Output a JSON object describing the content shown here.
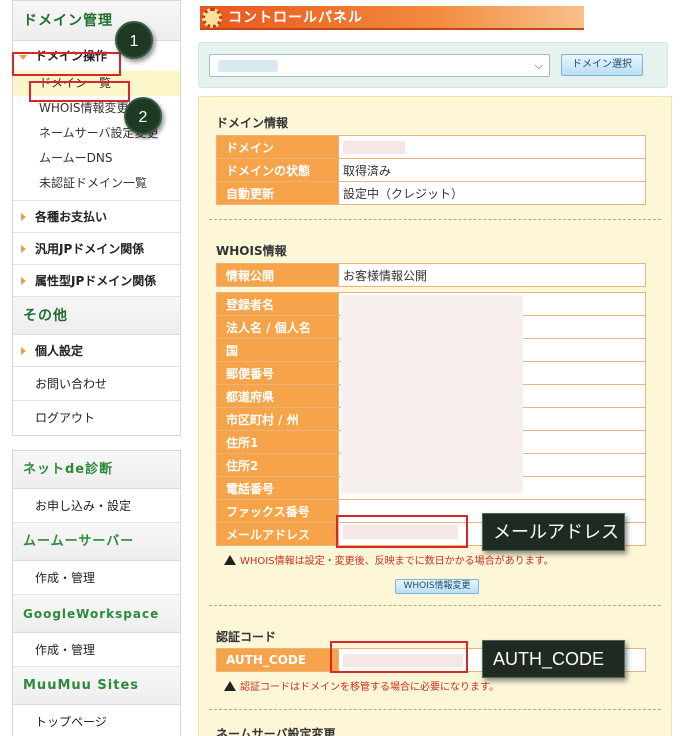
{
  "sidebar": {
    "domain_header": "ドメイン管理",
    "domain_ops": "ドメイン操作",
    "sub_items": [
      "ドメイン一覧",
      "WHOIS情報変更",
      "ネームサーバ設定変更",
      "ムームーDNS",
      "未認証ドメイン一覧"
    ],
    "sections": [
      "各種お支払い",
      "汎用JPドメイン関係",
      "属性型JPドメイン関係"
    ],
    "other_header": "その他",
    "other_items": [
      "個人設定",
      "お問い合わせ",
      "ログアウト"
    ],
    "shindan_header": "ネットde診断",
    "shindan_item": "お申し込み・設定",
    "server_header": "ムームーサーバー",
    "server_item": "作成・管理",
    "gws_header": "GoogleWorkspace",
    "gws_item": "作成・管理",
    "sites_header": "MuuMuu Sites",
    "sites_item": "トップページ"
  },
  "badges": [
    "1",
    "2"
  ],
  "main": {
    "title": "コントロールパネル",
    "select_button": "ドメイン選択",
    "domain_info": {
      "title": "ドメイン情報",
      "rows": [
        {
          "label": "ドメイン",
          "value": ""
        },
        {
          "label": "ドメインの状態",
          "value": "取得済み"
        },
        {
          "label": "自動更新",
          "value": "設定中（クレジット）"
        }
      ]
    },
    "whois": {
      "title": "WHOIS情報",
      "public_label": "情報公開",
      "public_value": "お客様情報公開",
      "rows": [
        "登録者名",
        "法人名 / 個人名",
        "国",
        "郵便番号",
        "都道府県",
        "市区町村 / 州",
        "住所1",
        "住所2",
        "電話番号",
        "ファックス番号",
        "メールアドレス"
      ],
      "warning": "WHOIS情報は設定・変更後、反映までに数日かかる場合があります。",
      "change_button": "WHOIS情報変更"
    },
    "auth": {
      "title": "認証コード",
      "label": "AUTH_CODE",
      "warning": "認証コードはドメインを移管する場合に必要になります。"
    },
    "ns_title": "ネームサーバ設定変更"
  },
  "callouts": {
    "email": "メールアドレス",
    "auth": "AUTH_CODE"
  },
  "colors": {
    "accent_orange": "#f7a349",
    "title_orange": "#e8561e",
    "highlight_red": "#d9262d",
    "sidebar_green": "#1f6f2f"
  }
}
